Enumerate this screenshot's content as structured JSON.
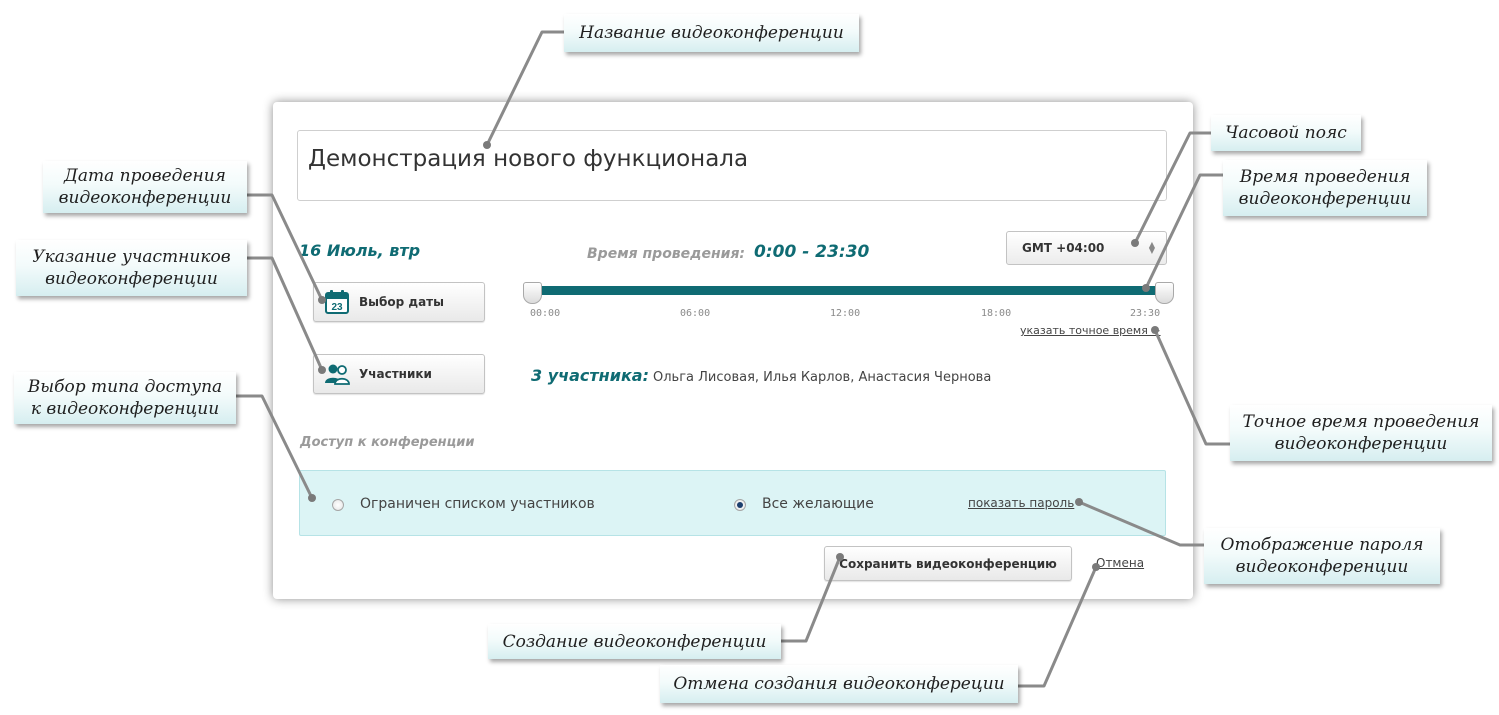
{
  "dialog": {
    "conference_title": "Демонстрация нового функционала",
    "date_heading": "16 Июль, втр",
    "date_button_label": "Выбор даты",
    "calendar_day": "23",
    "time_label": "Время проведения:",
    "time_value": "0:00 - 23:30",
    "timezone": "GMT +04:00",
    "slider": {
      "ticks": [
        "00:00",
        "06:00",
        "12:00",
        "18:00",
        "23:30"
      ],
      "range_start": "0:00",
      "range_end": "23:30"
    },
    "exact_time_link": "указать точное время >",
    "participants_button_label": "Участники",
    "participants_count": "3 участника:",
    "participants_names": "Ольга Лисовая, Илья Карлов, Анастасия Чернова",
    "access_heading": "Доступ к конференции",
    "access_options": [
      {
        "label": "Ограничен списком участников",
        "selected": false
      },
      {
        "label": "Все желающие",
        "selected": true
      }
    ],
    "show_password_link": "показать пароль",
    "save_button_label": "Сохранить видеоконференцию",
    "cancel_link": "Отмена"
  },
  "callouts": {
    "title": "Название видеоконференции",
    "date": "Дата проведения\nвидеоконференции",
    "participants": "Указание участников\nвидеоконференции",
    "access": "Выбор типа доступа\nк видеоконференции",
    "timezone": "Часовой пояс",
    "time": "Время проведения\nвидеоконференции",
    "exact_time": "Точное время проведения\nвидеоконференции",
    "password": "Отображение пароля\nвидеоконференции",
    "create": "Создание видеоконференции",
    "cancel": "Отмена создания видеоконфереции"
  },
  "colors": {
    "accent": "#0f6b73",
    "access_panel_bg": "#dcf4f5",
    "muted_label": "#9a9a9a"
  }
}
